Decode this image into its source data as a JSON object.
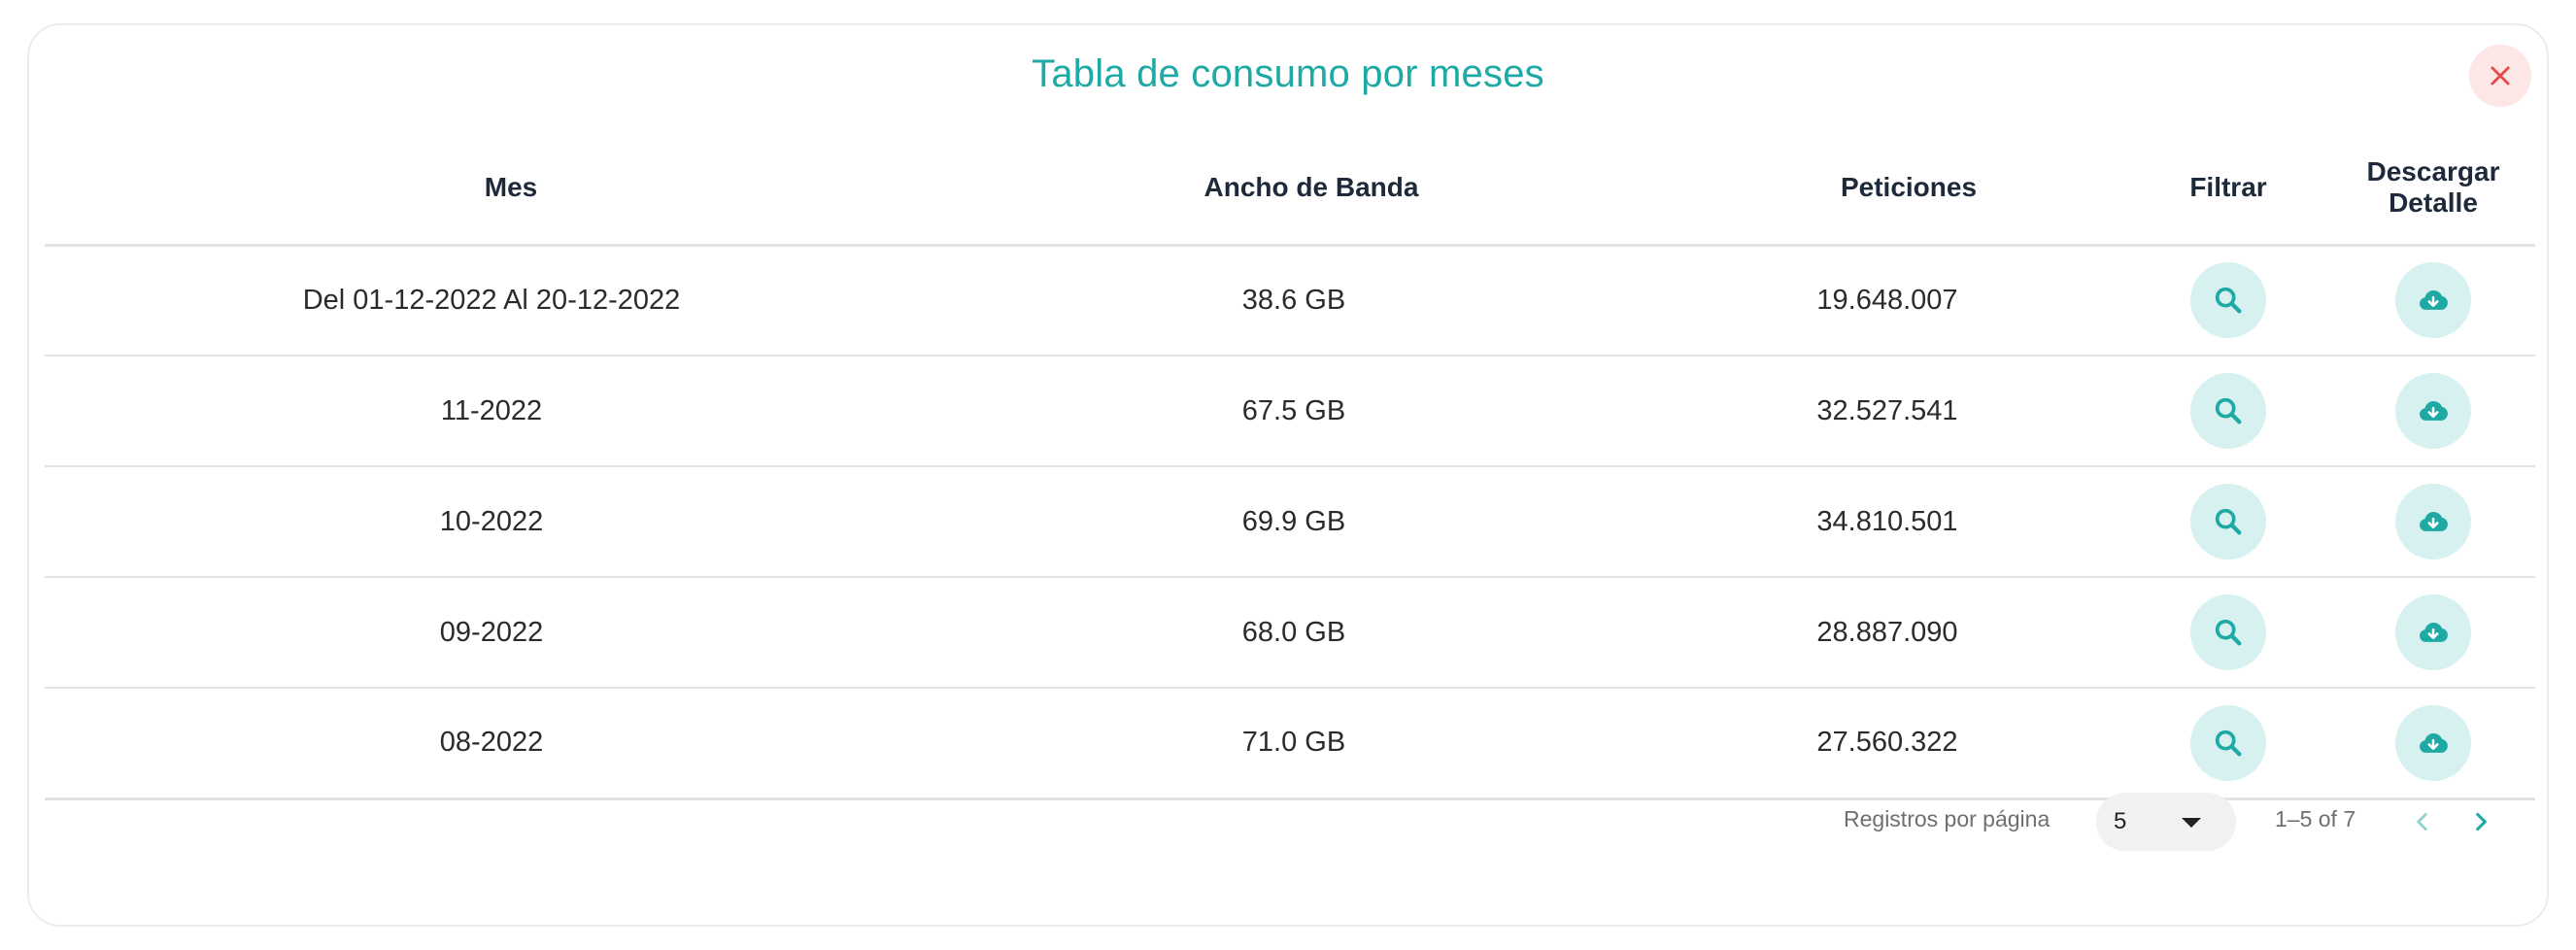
{
  "modal": {
    "title": "Tabla de consumo por meses",
    "accent_color": "#1fa9a5",
    "close_icon": "close-icon"
  },
  "table": {
    "headers": {
      "mes": "Mes",
      "banda": "Ancho de Banda",
      "peticiones": "Peticiones",
      "filtrar": "Filtrar",
      "descargar": "Descargar Detalle"
    },
    "rows": [
      {
        "mes": "Del 01-12-2022 Al 20-12-2022",
        "banda": "38.6 GB",
        "peticiones": "19.648.007"
      },
      {
        "mes": "11-2022",
        "banda": "67.5 GB",
        "peticiones": "32.527.541"
      },
      {
        "mes": "10-2022",
        "banda": "69.9 GB",
        "peticiones": "34.810.501"
      },
      {
        "mes": "09-2022",
        "banda": "68.0 GB",
        "peticiones": "28.887.090"
      },
      {
        "mes": "08-2022",
        "banda": "71.0 GB",
        "peticiones": "27.560.322"
      }
    ],
    "filter_icon": "search-icon",
    "download_icon": "cloud-download-icon"
  },
  "pagination": {
    "rows_per_page_label": "Registros por página",
    "rows_per_page_value": "5",
    "range_text": "1–5 of 7",
    "prev_icon": "chevron-left-icon",
    "next_icon": "chevron-right-icon"
  }
}
